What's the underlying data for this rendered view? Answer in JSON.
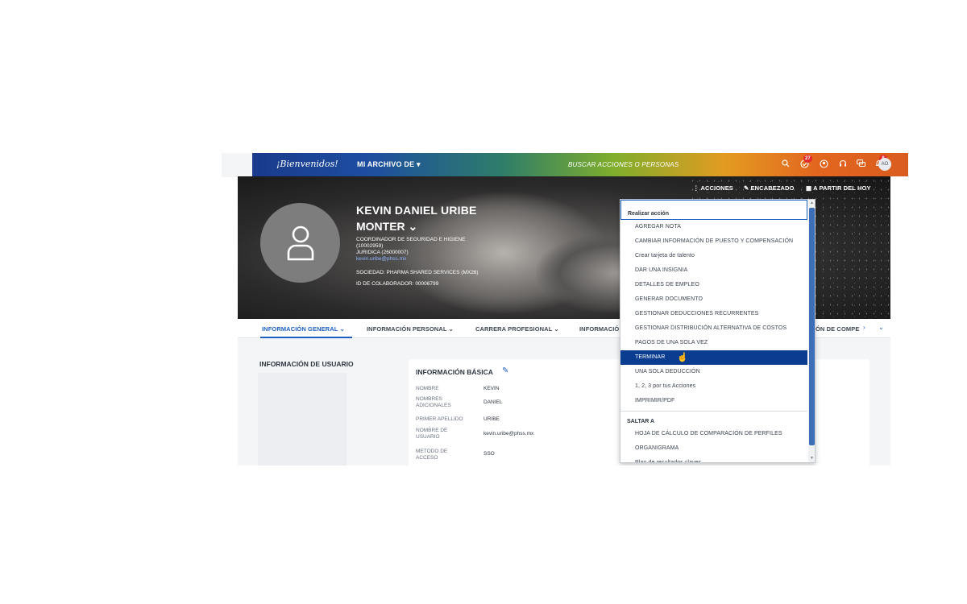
{
  "topbar": {
    "logo": "¡Bienvenidos!",
    "menu": "MI ARCHIVO DE ▾",
    "search": "BUSCAR ACCIONES O PERSONAS",
    "icons": [
      "search-icon",
      "approvals-icon",
      "people-icon",
      "headset-icon",
      "chat-icon",
      "bell-icon"
    ],
    "approvals_badge": "27",
    "notifications_badge": "8",
    "avatar_initials": "AO"
  },
  "profile": {
    "name_line1": "KEVIN DANIEL URIBE",
    "name_line2": "MONTER ⌄",
    "position": "COORDINADOR DE SEGURIDAD E HIGIENE",
    "position_code": "(10002959)",
    "department": "JURIDICA (26000007)",
    "email": "kevin.uribe@phss.mx",
    "company": "SOCIEDAD: PHARMA SHARED SERVICES (MX26)",
    "employee_id": "ID DE COLABORADOR: 00006799"
  },
  "header_actions": {
    "actions": "⋮ ACCIONES",
    "header": "✎ ENCABEZADO",
    "date": "▦ A PARTIR DEL HOY"
  },
  "tabs": [
    {
      "label": "INFORMACIÓN GENERAL ⌄"
    },
    {
      "label": "INFORMACIÓN PERSONAL ⌄"
    },
    {
      "label": "CARRERA PROFESIONAL ⌄"
    },
    {
      "label": "INFORMACIÓ"
    },
    {
      "label": "ÓN DE COMPE"
    }
  ],
  "section": {
    "user_info_label": "INFORMACIÓN DE USUARIO",
    "card_title": "INFORMACIÓN BÁSICA",
    "fields": [
      {
        "label": "NOMBRE",
        "value": "KEVIN"
      },
      {
        "label": "NOMBRES ADICIONALES",
        "value": "DANIEL"
      },
      {
        "label": "PRIMER APELLIDO",
        "value": "URIBE"
      },
      {
        "label": "NOMBRE DE USUARIO",
        "value": "kevin.uribe@phss.mx"
      },
      {
        "label": "METODO DE ACCESO",
        "value": "SSO"
      }
    ]
  },
  "dropdown": {
    "header": "Realizar acción",
    "items": [
      "AGREGAR NOTA",
      "CAMBIAR INFORMACIÓN DE PUESTO Y COMPENSACIÓN",
      "Crear tarjeta de talento",
      "DAR UNA INSIGNIA",
      "DETALLES DE EMPLEO",
      "GENERAR DOCUMENTO",
      "GESTIONAR DEDUCCIONES RECURRENTES",
      "GESTIONAR DISTRIBUCIÓN ALTERNATIVA DE COSTOS",
      "PAGOS DE UNA SOLA VEZ",
      "TERMINAR",
      "UNA SOLA DEDUCCIÓN",
      "1, 2, 3 por tus Acciones",
      "IMPRIMIR/PDF"
    ],
    "selected_index": 9,
    "group_label": "SALTAR A",
    "jump_items": [
      "HOJA DE CÁLCULO DE COMPARACIÓN DE PERFILES",
      "ORGANIGRAMA",
      "Plan de resultados claves"
    ]
  }
}
